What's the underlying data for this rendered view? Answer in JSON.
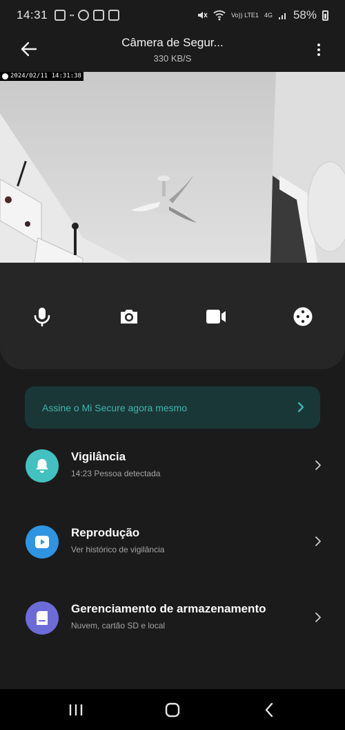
{
  "status_bar": {
    "time": "14:31",
    "battery": "58%",
    "lte_label": "Vo)) LTE1",
    "network_small": "4G"
  },
  "header": {
    "title": "Câmera de Segur...",
    "subtitle": "330 KB/S"
  },
  "feed": {
    "timestamp": "2024/02/11  14:31:38"
  },
  "controls": [
    "microphone-icon",
    "camera-icon",
    "video-icon",
    "palette-icon"
  ],
  "promo": {
    "text": "Assine o Mi Secure agora mesmo",
    "accent": "#3fb6ad"
  },
  "items": [
    {
      "title": "Vigilância",
      "subtitle": "14:23 Pessoa detectada",
      "icon": "bell-icon",
      "color": "#43c1c0"
    },
    {
      "title": "Reprodução",
      "subtitle": "Ver histórico de vigilância",
      "icon": "play-icon",
      "color": "#2f94e2"
    },
    {
      "title": "Gerenciamento de armazenamento",
      "subtitle": "Nuvem, cartão SD e local",
      "icon": "storage-icon",
      "color": "#6c6bd8"
    }
  ]
}
